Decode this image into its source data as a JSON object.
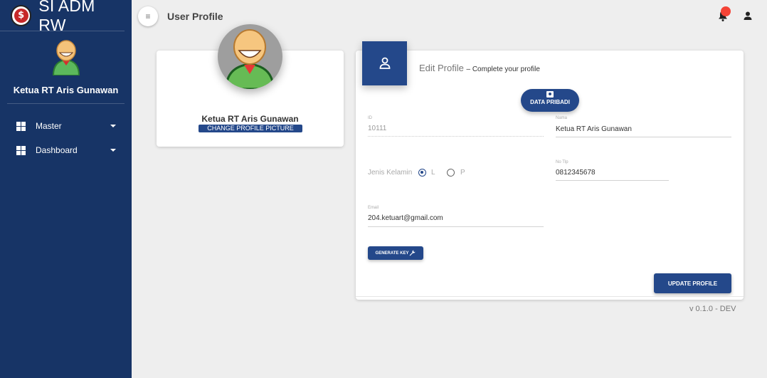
{
  "brand": {
    "title": "SI ADM RW",
    "logo_glyph": "$"
  },
  "sidebar": {
    "user_name": "Ketua RT Aris Gunawan",
    "items": [
      {
        "label": "Master",
        "icon": "dashboard-grid-icon"
      },
      {
        "label": "Dashboard",
        "icon": "dashboard-grid-icon"
      }
    ]
  },
  "header": {
    "title": "User Profile",
    "menu_glyph": "≡"
  },
  "profile": {
    "name": "Ketua RT Aris Gunawan",
    "change_picture_label": "CHANGE PROFILE PICTURE"
  },
  "edit": {
    "title": "Edit Profile",
    "subtitle": "– Complete your profile",
    "tab_label": "DATA PRIBADI",
    "fields": {
      "id": {
        "label": "ID",
        "value": "10111"
      },
      "nama": {
        "label": "Nama",
        "value": "Ketua RT Aris Gunawan"
      },
      "jenis_kelamin": {
        "label": "Jenis Kelamin",
        "options": [
          "L",
          "P"
        ],
        "selected": "L"
      },
      "no_tlp": {
        "label": "No Tlp",
        "value": "0812345678"
      },
      "email": {
        "label": "Email",
        "value": "204.ketuart@gmail.com"
      }
    },
    "generate_key_label": "GENERATE KEY",
    "update_label": "UPDATE PROFILE"
  },
  "footer": {
    "version": "v 0.1.0 - DEV"
  },
  "colors": {
    "sidebar": "#173466",
    "primary": "#24488a",
    "notification": "#f44336"
  }
}
